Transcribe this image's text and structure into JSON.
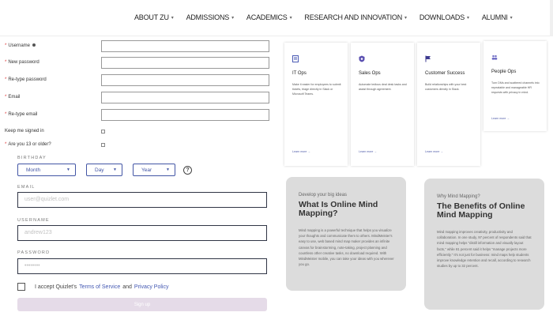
{
  "nav": {
    "items": [
      {
        "label": "ABOUT ZU"
      },
      {
        "label": "ADMISSIONS"
      },
      {
        "label": "ACADEMICS"
      },
      {
        "label": "RESEARCH AND INNOVATION"
      },
      {
        "label": "DOWNLOADS"
      },
      {
        "label": "ALUMNI"
      }
    ]
  },
  "registration": {
    "username_label": "Username",
    "new_password_label": "New password",
    "retype_password_label": "Re-type password",
    "email_label": "Email",
    "retype_email_label": "Re-type email",
    "keep_signed_in_label": "Keep me signed in",
    "age_label": "Are you 13 or older?",
    "required_mark": "*"
  },
  "signup": {
    "birthday_label": "BIRTHDAY",
    "month": "Month",
    "day": "Day",
    "year": "Year",
    "help": "?",
    "email_label": "EMAIL",
    "email_placeholder": "user@quizlet.com",
    "username_label": "USERNAME",
    "username_placeholder": "andrew123",
    "password_label": "PASSWORD",
    "password_placeholder": "••••••••",
    "terms_prefix": "I accept Quizlet's",
    "terms_link": "Terms of Service",
    "terms_and": "and",
    "privacy_link": "Privacy Policy",
    "signup_button": "Sign up"
  },
  "cards": [
    {
      "title": "IT Ops",
      "icon": "document-icon",
      "icon_color": "#4b5bb5",
      "desc": "Make it easier for employees to submit tickets, triage directly in Slack or Microsoft Teams.",
      "more": "Learn more →"
    },
    {
      "title": "Sales Ops",
      "icon": "shield-icon",
      "icon_color": "#5a4fb0",
      "desc": "Automate tedious deal desk tasks and assist through agreement.",
      "more": "Learn more →"
    },
    {
      "title": "Customer Success",
      "icon": "flag-icon",
      "icon_color": "#3d3a8f",
      "desc": "Build relationships with your best customers directly in Slack.",
      "more": "Learn more →"
    },
    {
      "title": "People Ops",
      "icon": "people-icon",
      "icon_color": "#6f6cc5",
      "desc": "Turn DMs and scattered channels into repeatable and manageable HR requests with privacy in mind.",
      "more": "Learn more →"
    }
  ],
  "mindmap": {
    "left": {
      "kicker": "Develop your big ideas",
      "title": "What Is Online Mind Mapping?",
      "body": "Mind mapping is a powerful technique that helps you visualize your thoughts and communicate them to others. MindMeister's easy to use, web based mind map maker provides an infinite canvas for brainstorming, note-taking, project planning and countless other creative tasks, no download required. With MindMeister mobile, you can take your ideas with you wherever you go."
    },
    "right": {
      "kicker": "Why Mind Mapping?",
      "title": "The Benefits of Online Mind Mapping",
      "body": "Mind mapping improves creativity, productivity and collaboration. In one study, 97 percent of respondents said that mind mapping helps \"distill information and visually layout facts,\" while 81 percent said it helps \"manage projects more efficiently.\" It's not just for business: mind maps help students improve knowledge retention and recall, according to research studies by up to 32 percent."
    }
  }
}
